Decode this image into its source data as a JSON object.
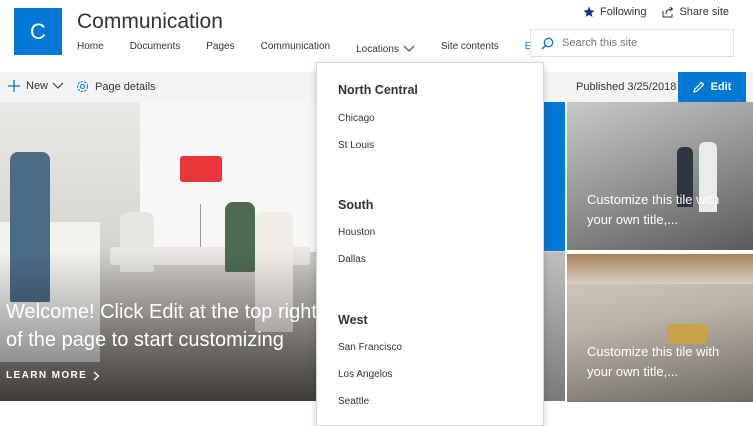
{
  "site": {
    "logo_letter": "C",
    "title": "Communication"
  },
  "nav": {
    "items": [
      "Home",
      "Documents",
      "Pages",
      "Communication",
      "Locations",
      "Site contents",
      "Edit"
    ]
  },
  "header_actions": {
    "following_label": "Following",
    "share_label": "Share site"
  },
  "search": {
    "placeholder": "Search this site"
  },
  "command_bar": {
    "new_label": "New",
    "page_details_label": "Page details",
    "published_text": "Published 3/25/2018",
    "edit_label": "Edit"
  },
  "hero": {
    "main_text": "Welcome! Click Edit at the top right of the page to start customizing",
    "learn_more": "LEARN MORE",
    "tile_text_1": "Customize this tile with your own title,...",
    "tile_text_2": "Customize this tile with your own title,..."
  },
  "locations_menu": {
    "groups": [
      {
        "heading": "North Central",
        "links": [
          "Chicago",
          "St Louis"
        ]
      },
      {
        "heading": "South",
        "links": [
          "Houston",
          "Dallas"
        ]
      },
      {
        "heading": "West",
        "links": [
          "San Francisco",
          "Los Angelos",
          "Seattle"
        ]
      }
    ]
  },
  "colors": {
    "accent": "#0078d4",
    "lamp": "#e8363b"
  },
  "icons": {
    "following": "star-icon",
    "share": "share-icon",
    "search": "search-icon",
    "new": "plus-icon",
    "page_details": "gear-icon",
    "edit": "pencil-icon",
    "caret": "chevron-down-icon",
    "learn_more": "chevron-right-icon"
  }
}
